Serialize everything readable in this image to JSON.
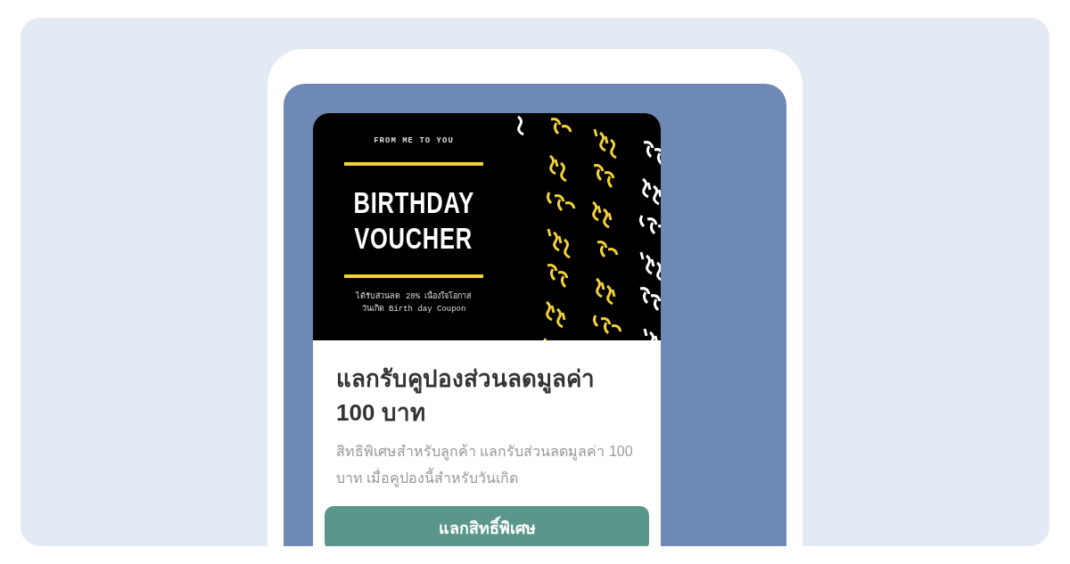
{
  "voucher": {
    "eyebrow": "FROM ME TO YOU",
    "title_lines": [
      "BIRTHDAY",
      "VOUCHER"
    ],
    "caption_lines": [
      "ได้รับส่วนลด 20% เนื่องใจโอกาส",
      "วันเกิด Birth day Coupon"
    ]
  },
  "offer": {
    "title": "แลกรับคูปองส่วนลดมูลค่า 100 บาท",
    "description": "สิทธิพิเศษสำหรับลูกค้า แลกรับส่วนลดมูลค่า 100 บาท เมื่อคูปองนี้สำหรับวันเกิด",
    "button": "แลกสิทธิ์พิเศษ"
  }
}
